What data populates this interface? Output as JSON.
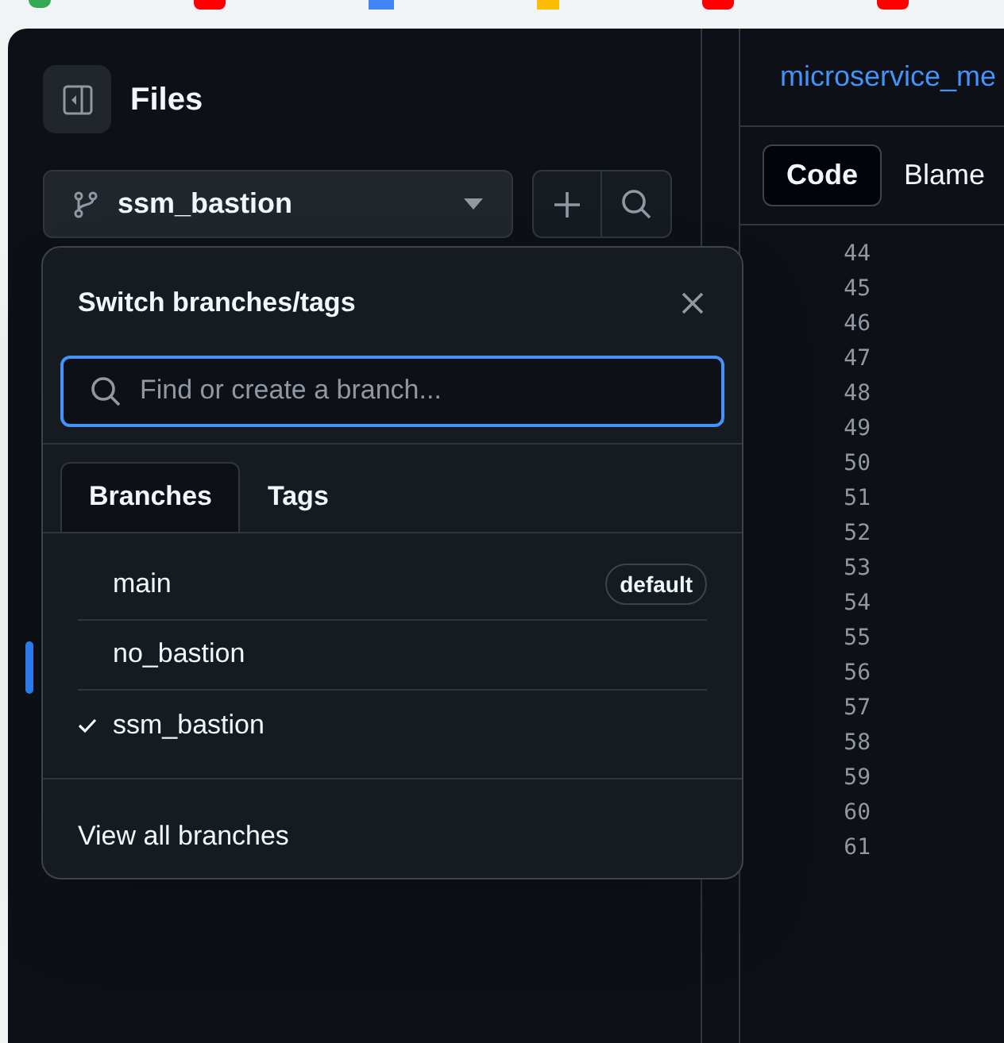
{
  "sidebar": {
    "title": "Files",
    "branch_button": {
      "label": "ssm_bastion"
    }
  },
  "branch_menu": {
    "title": "Switch branches/tags",
    "search": {
      "placeholder": "Find or create a branch..."
    },
    "tabs": [
      {
        "label": "Branches",
        "selected": true
      },
      {
        "label": "Tags",
        "selected": false
      }
    ],
    "branches": [
      {
        "name": "main",
        "checked": false,
        "badge": "default"
      },
      {
        "name": "no_bastion",
        "checked": false
      },
      {
        "name": "ssm_bastion",
        "checked": true
      }
    ],
    "footer_link": "View all branches"
  },
  "file_view": {
    "title": "microservice_me",
    "tabs": [
      {
        "label": "Code",
        "selected": true
      },
      {
        "label": "Blame",
        "selected": false
      }
    ],
    "line_numbers": [
      "44",
      "45",
      "46",
      "47",
      "48",
      "49",
      "50",
      "51",
      "52",
      "53",
      "54",
      "55",
      "56",
      "57",
      "58",
      "59",
      "60",
      "61"
    ]
  }
}
